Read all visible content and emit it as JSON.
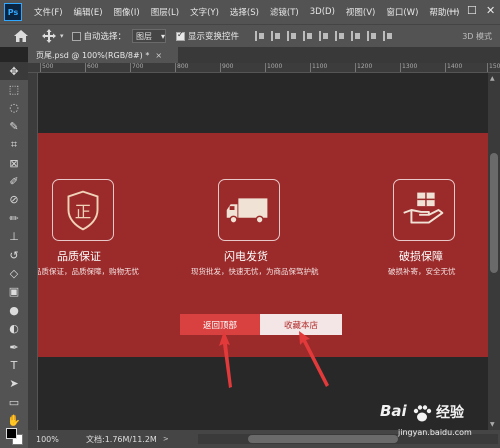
{
  "menubar": {
    "logo": "Ps",
    "items": [
      "文件(F)",
      "编辑(E)",
      "图像(I)",
      "图层(L)",
      "文字(Y)",
      "选择(S)",
      "滤镜(T)",
      "3D(D)",
      "视图(V)",
      "窗口(W)",
      "帮助(H)"
    ],
    "window_controls": [
      "—",
      "☐",
      "✕"
    ]
  },
  "optionsbar": {
    "auto_select_label": "自动选择：",
    "auto_select_value": "图层",
    "show_transform_label": "显示变换控件",
    "mode_3d_label": "3D 模式"
  },
  "document_tab": {
    "title": "页尾.psd @ 100%(RGB/8#) *",
    "close": "×"
  },
  "ruler": {
    "ticks": [
      "500",
      "600",
      "700",
      "800",
      "900",
      "1000",
      "1100",
      "1200",
      "1300",
      "1400",
      "1500"
    ]
  },
  "canvas": {
    "banner_color": "#9b2a2a",
    "features": [
      {
        "icon": "shield-zheng-icon",
        "glyph": "正",
        "title": "品质保证",
        "desc": "品质保证，品质保障，购物无忧"
      },
      {
        "icon": "truck-icon",
        "title": "闪电发货",
        "desc": "现货批发，快速无忧，为商品保驾护航"
      },
      {
        "icon": "gift-hand-icon",
        "title": "破损保障",
        "desc": "破损补寄，安全无忧"
      }
    ],
    "buttons": {
      "back_to_top": "返回顶部",
      "add_favorite": "收藏本店"
    },
    "annotation_arrow_color": "#e23a3a"
  },
  "statusbar": {
    "zoom": "100%",
    "doc_info": "文档:1.76M/11.2M",
    "arrow": ">"
  },
  "watermark": {
    "brand": "Bai",
    "brand2": "经验",
    "url": "jingyan.baidu.com"
  }
}
